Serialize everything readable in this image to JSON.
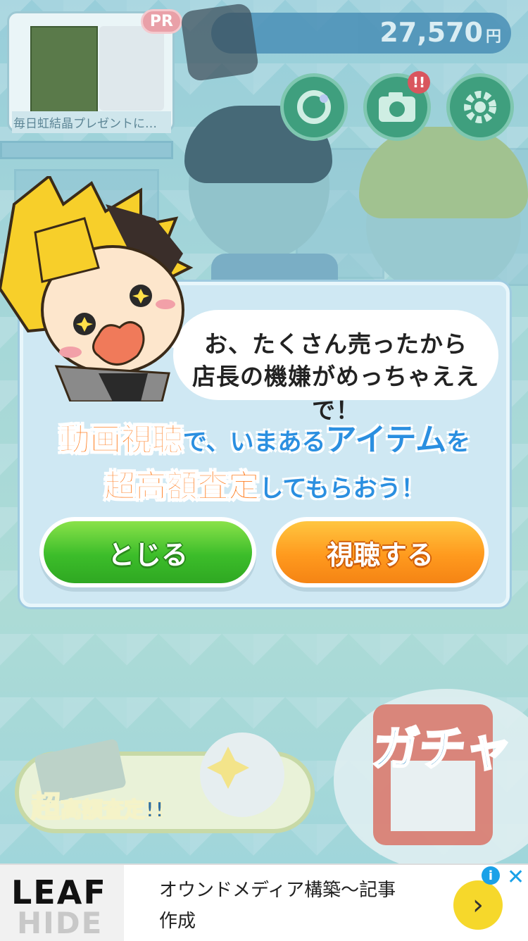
{
  "pr": {
    "badge": "PR",
    "caption": "毎日虹結晶プレゼントに…"
  },
  "money": {
    "value": "27,570",
    "unit": "円"
  },
  "icons": [
    "refresh-ring-icon",
    "camera-icon",
    "gear-icon"
  ],
  "camera_alert": "!!",
  "modal": {
    "speech_line1": "お、たくさん売ったから",
    "speech_line2": "店長の機嫌がめっちゃええで！",
    "line1": {
      "part1": "動画視聴",
      "part2": "で、いまある",
      "part3": "アイテム",
      "part4": "を"
    },
    "line2": {
      "part1": "超高額査定",
      "part2": "してもらおう！"
    },
    "close_button": "とじる",
    "watch_button": "視聴する"
  },
  "bottom": {
    "appraisal_big": "超",
    "appraisal_rest": "高額査定!!",
    "gacha": "ガチャ"
  },
  "ad": {
    "logo_top": "LEAF",
    "logo_bottom": "HIDE",
    "text_line1": "オウンドメディア構築～記事",
    "text_line2": "作成",
    "info": "i",
    "close": "✕",
    "arrow": "›"
  },
  "colors": {
    "close_button": "#3cbd2a",
    "watch_button": "#ff9a1e",
    "orange_text": "#ff7a1a",
    "blue_text": "#2b8fe0"
  }
}
